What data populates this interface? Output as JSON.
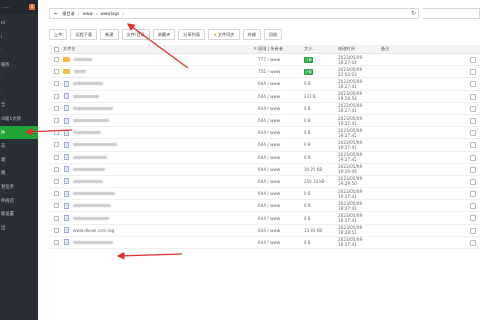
{
  "sidebar": {
    "brand": "......",
    "badge": "0",
    "items": [
      {
        "label": "m"
      },
      {
        "label": "i"
      },
      {
        "label": "·"
      },
      {
        "label": "服务"
      },
      {
        "label": "·"
      },
      {
        "label": "·"
      },
      {
        "label": "全"
      },
      {
        "label": "/0面1大领"
      },
      {
        "label": "件",
        "active": true
      },
      {
        "label": "志"
      },
      {
        "label": "端"
      },
      {
        "label": "端"
      },
      {
        "label": "划任务"
      },
      {
        "label": "件商店"
      },
      {
        "label": "板设置"
      },
      {
        "label": "出"
      }
    ]
  },
  "address": {
    "crumbs": [
      "根目录",
      "www",
      "wwwlogs"
    ]
  },
  "toolbar": {
    "buttons": [
      {
        "label": "上传"
      },
      {
        "label": "远程下载"
      },
      {
        "label": "新建"
      },
      {
        "label": "文件/目录"
      },
      {
        "label": "收藏夹"
      },
      {
        "label": "分享列表"
      },
      {
        "label": "文件同步",
        "star": true
      },
      {
        "label": "终端"
      },
      {
        "label": "回收"
      }
    ]
  },
  "table": {
    "headers": {
      "name": "文件名",
      "perm": "权限 | 所有者",
      "size": "大小",
      "time": "修改时间",
      "note": "备注"
    },
    "calc_label": "计算",
    "rows": [
      {
        "type": "folder",
        "name_hidden": true,
        "perm": "777 / www",
        "size": "",
        "calc": true,
        "time": "2023/05/09 19:27:04"
      },
      {
        "type": "folder",
        "name_hidden": true,
        "perm": "755 / www",
        "size": "",
        "calc": true,
        "time": "2023/05/09 22:03:03"
      },
      {
        "type": "file",
        "name_hidden": true,
        "perm": "644 / www",
        "size": "0 B",
        "time": "2023/05/09 19:27:41"
      },
      {
        "type": "file",
        "name_hidden": true,
        "perm": "644 / www",
        "size": "231 B",
        "time": "2023/05/09 19:28:54"
      },
      {
        "type": "file",
        "name_hidden": true,
        "perm": "644 / www",
        "size": "0 B",
        "time": "2023/05/09 19:27:41"
      },
      {
        "type": "file",
        "name_hidden": true,
        "perm": "644 / www",
        "size": "0 B",
        "time": "2023/05/09 19:27:41"
      },
      {
        "type": "file",
        "name_hidden": true,
        "perm": "644 / www",
        "size": "0 B",
        "time": "2023/05/09 19:27:41"
      },
      {
        "type": "file",
        "name_hidden": true,
        "perm": "644 / www",
        "size": "0 B",
        "time": "2023/05/09 19:27:41"
      },
      {
        "type": "file",
        "name_hidden": true,
        "perm": "644 / www",
        "size": "0 B",
        "time": "2023/05/09 19:27:41"
      },
      {
        "type": "file",
        "name_hidden": true,
        "perm": "644 / www",
        "size": "30.25 KB",
        "time": "2023/05/09 19:29:49"
      },
      {
        "type": "file",
        "name_hidden": true,
        "perm": "644 / www",
        "size": "250.74 KB",
        "time": "2023/05/09 19:29:50"
      },
      {
        "type": "file",
        "name_hidden": true,
        "perm": "644 / www",
        "size": "0 B",
        "time": "2023/05/09 19:27:41"
      },
      {
        "type": "file",
        "name_hidden": true,
        "perm": "644 / www",
        "size": "0 B",
        "time": "2023/05/09 19:27:41"
      },
      {
        "type": "file",
        "name_hidden": true,
        "perm": "644 / www",
        "size": "0 B",
        "time": "2023/05/09 19:27:41"
      },
      {
        "type": "file",
        "name": "www.dkewl.com.log",
        "name_hidden": false,
        "perm": "644 / www",
        "size": "15.93 KB",
        "time": "2023/05/09 19:28:51"
      },
      {
        "type": "file",
        "name_hidden": true,
        "perm": "644 / www",
        "size": "0 B",
        "time": "2023/05/09 19:27:41"
      }
    ]
  },
  "colors": {
    "accent": "#20a53a",
    "arrow": "#e03030",
    "sidebar": "#2a2f36"
  }
}
